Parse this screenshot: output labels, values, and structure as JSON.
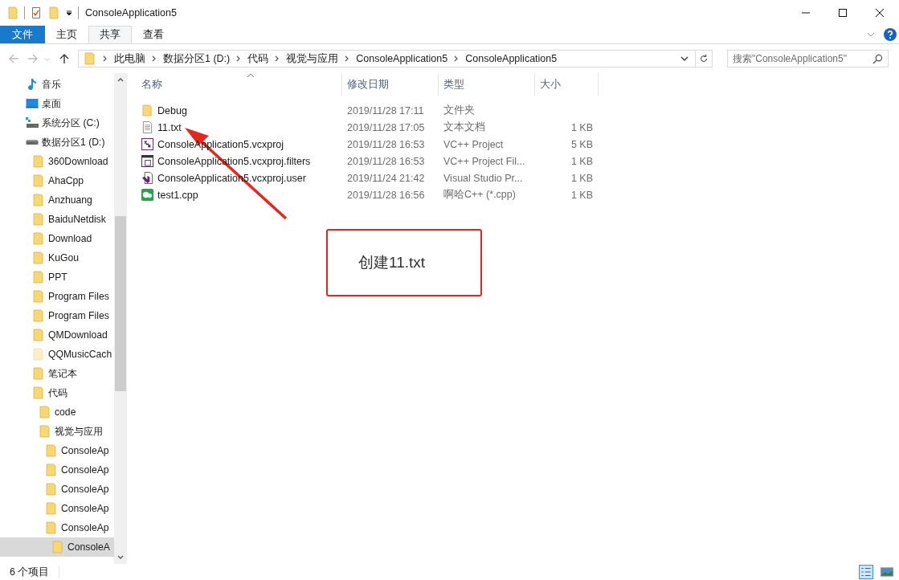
{
  "window": {
    "title": "ConsoleApplication5"
  },
  "ribbon_tabs": [
    {
      "label": "文件",
      "kind": "file",
      "selected": false
    },
    {
      "label": "主页",
      "kind": "tab",
      "selected": false
    },
    {
      "label": "共享",
      "kind": "tab",
      "selected": true
    },
    {
      "label": "查看",
      "kind": "tab",
      "selected": false
    }
  ],
  "breadcrumb": [
    "此电脑",
    "数据分区1 (D:)",
    "代码",
    "视觉与应用",
    "ConsoleApplication5",
    "ConsoleApplication5"
  ],
  "search": {
    "placeholder": "搜索\"ConsoleApplication5\""
  },
  "tree": [
    {
      "label": "音乐",
      "kind": "music",
      "selected": false
    },
    {
      "label": "桌面",
      "kind": "desktop",
      "selected": false
    },
    {
      "label": "系统分区 (C:)",
      "kind": "system-drive",
      "selected": false
    },
    {
      "label": "数据分区1 (D:)",
      "kind": "drive",
      "selected": false,
      "children": [
        {
          "label": "360Download",
          "kind": "folder",
          "selected": false
        },
        {
          "label": "AhaCpp",
          "kind": "folder",
          "selected": false
        },
        {
          "label": "Anzhuang",
          "kind": "folder",
          "selected": false
        },
        {
          "label": "BaiduNetdisk",
          "kind": "folder",
          "selected": false
        },
        {
          "label": "Download",
          "kind": "folder",
          "selected": false
        },
        {
          "label": "KuGou",
          "kind": "folder",
          "selected": false
        },
        {
          "label": "PPT",
          "kind": "folder",
          "selected": false
        },
        {
          "label": "Program Files",
          "kind": "folder",
          "selected": false
        },
        {
          "label": "Program Files",
          "kind": "folder",
          "selected": false
        },
        {
          "label": "QMDownload",
          "kind": "folder",
          "selected": false
        },
        {
          "label": "QQMusicCach",
          "kind": "hidden-folder",
          "selected": false
        },
        {
          "label": "笔记本",
          "kind": "folder",
          "selected": false
        },
        {
          "label": "代码",
          "kind": "folder",
          "selected": false,
          "children": [
            {
              "label": "code",
              "kind": "folder",
              "selected": false
            },
            {
              "label": "视觉与应用",
              "kind": "folder",
              "selected": false,
              "children": [
                {
                  "label": "ConsoleAp",
                  "kind": "folder",
                  "selected": false
                },
                {
                  "label": "ConsoleAp",
                  "kind": "folder",
                  "selected": false
                },
                {
                  "label": "ConsoleAp",
                  "kind": "folder",
                  "selected": false
                },
                {
                  "label": "ConsoleAp",
                  "kind": "folder",
                  "selected": false
                },
                {
                  "label": "ConsoleAp",
                  "kind": "folder",
                  "selected": false,
                  "children": [
                    {
                      "label": "ConsoleA",
                      "kind": "folder",
                      "selected": true
                    }
                  ]
                }
              ]
            }
          ]
        }
      ]
    }
  ],
  "columns": [
    "名称",
    "修改日期",
    "类型",
    "大小"
  ],
  "files": [
    {
      "name": "Debug",
      "kind": "folder",
      "date": "2019/11/28 17:11",
      "type": "文件夹"
    },
    {
      "name": "11.txt",
      "kind": "text",
      "date": "2019/11/28 17:05",
      "type": "文本文档",
      "size": "1 KB"
    },
    {
      "name": "ConsoleApplication5.vcxproj",
      "kind": "project",
      "date": "2019/11/28 16:53",
      "type": "VC++ Project",
      "size": "5 KB"
    },
    {
      "name": "ConsoleApplication5.vcxproj.filters",
      "kind": "filters",
      "date": "2019/11/28 16:53",
      "type": "VC++ Project Fil...",
      "size": "1 KB"
    },
    {
      "name": "ConsoleApplication5.vcxproj.user",
      "kind": "vs",
      "date": "2019/11/24 21:42",
      "type": "Visual Studio Pr...",
      "size": "1 KB"
    },
    {
      "name": "test1.cpp",
      "kind": "cpp",
      "date": "2019/11/28 16:56",
      "type": "啊哈C++ (*.cpp)",
      "size": "1 KB"
    }
  ],
  "annotation": {
    "text": "创建11.txt"
  },
  "status_bar": {
    "count": "6 个项目"
  }
}
